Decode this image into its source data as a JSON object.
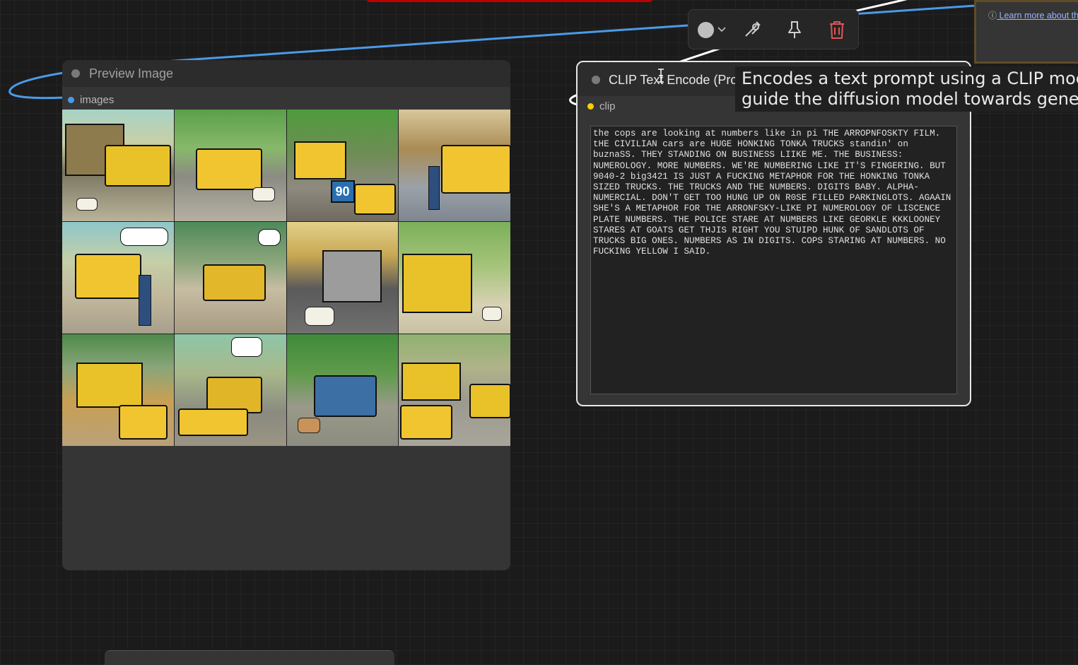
{
  "canvas": {
    "background": "#1b1b1b",
    "link_colors": {
      "image": "#4a9be8",
      "clip": "#ffffff",
      "selected_outline": "#e6e6e6"
    }
  },
  "note_node": {
    "link_text": "Learn more about th",
    "info_icon": "info-icon"
  },
  "preview_node": {
    "title": "Preview Image",
    "input": {
      "label": "images",
      "color": "#4a9be8"
    },
    "image_grid": {
      "rows": 3,
      "cols": 4,
      "tile_count": 12
    }
  },
  "clip_node": {
    "title": "CLIP Text Encode (Pro",
    "input": {
      "label": "clip",
      "color": "#ffcc00"
    },
    "prompt_text": "the cops are looking at numbers like in pi THE ARROPNFOSKTY FILM.\ntHE CIVILIAN cars are HUGE HONKING TONKA TRUCKS standin' on\nbuznaSS. THEY STANDING ON BUSINESS LIIKE ME. THE BUSINESS:\nNUMEROLOGY. MORE NUMBERS. WE'RE NUMBERING LIKE IT'S FINGERING. BUT\n9040-2 big3421 IS JUST A FUCKING METAPHOR FOR THE HONKING TONKA\nSIZED TRUCKS. THE TRUCKS AND THE NUMBERS. DIGITS BABY. ALPHA-\nNUMERCIAL. DON'T GET TOO HUNG UP ON R0SE FILLED PARKINGLOTS. AGAAIN\nSHE'S A METAPHOR FOR THE ARRONFSKY-LIKE PI NUMEROLOGY OF LISCENCE\nPLATE NUMBERS. THE POLICE STARE AT NUMBERS LIKE GEORKLE KKKLOONEY\nSTARES AT GOATS GET THJIS RIGHT YOU STUIPD HUNK OF SANDLOTS OF\nTRUCKS BIG ONES. NUMBERS AS IN DIGITS. COPS STARING AT NUMBERS. NO\nFUCKING YELLOW I SAID."
  },
  "tooltip": {
    "line1": "Encodes a text prompt using a CLIP moc",
    "line2": "guide the diffusion model towards gene"
  },
  "selection_toolbar": {
    "color_picker": {
      "icon": "color-circle-icon",
      "dropdown_icon": "chevron-down-icon",
      "color": "#bfbfbf"
    },
    "bypass": {
      "icon": "bypass-icon"
    },
    "pin": {
      "icon": "pin-icon"
    },
    "delete": {
      "icon": "trash-icon",
      "color": "#e05555"
    }
  }
}
